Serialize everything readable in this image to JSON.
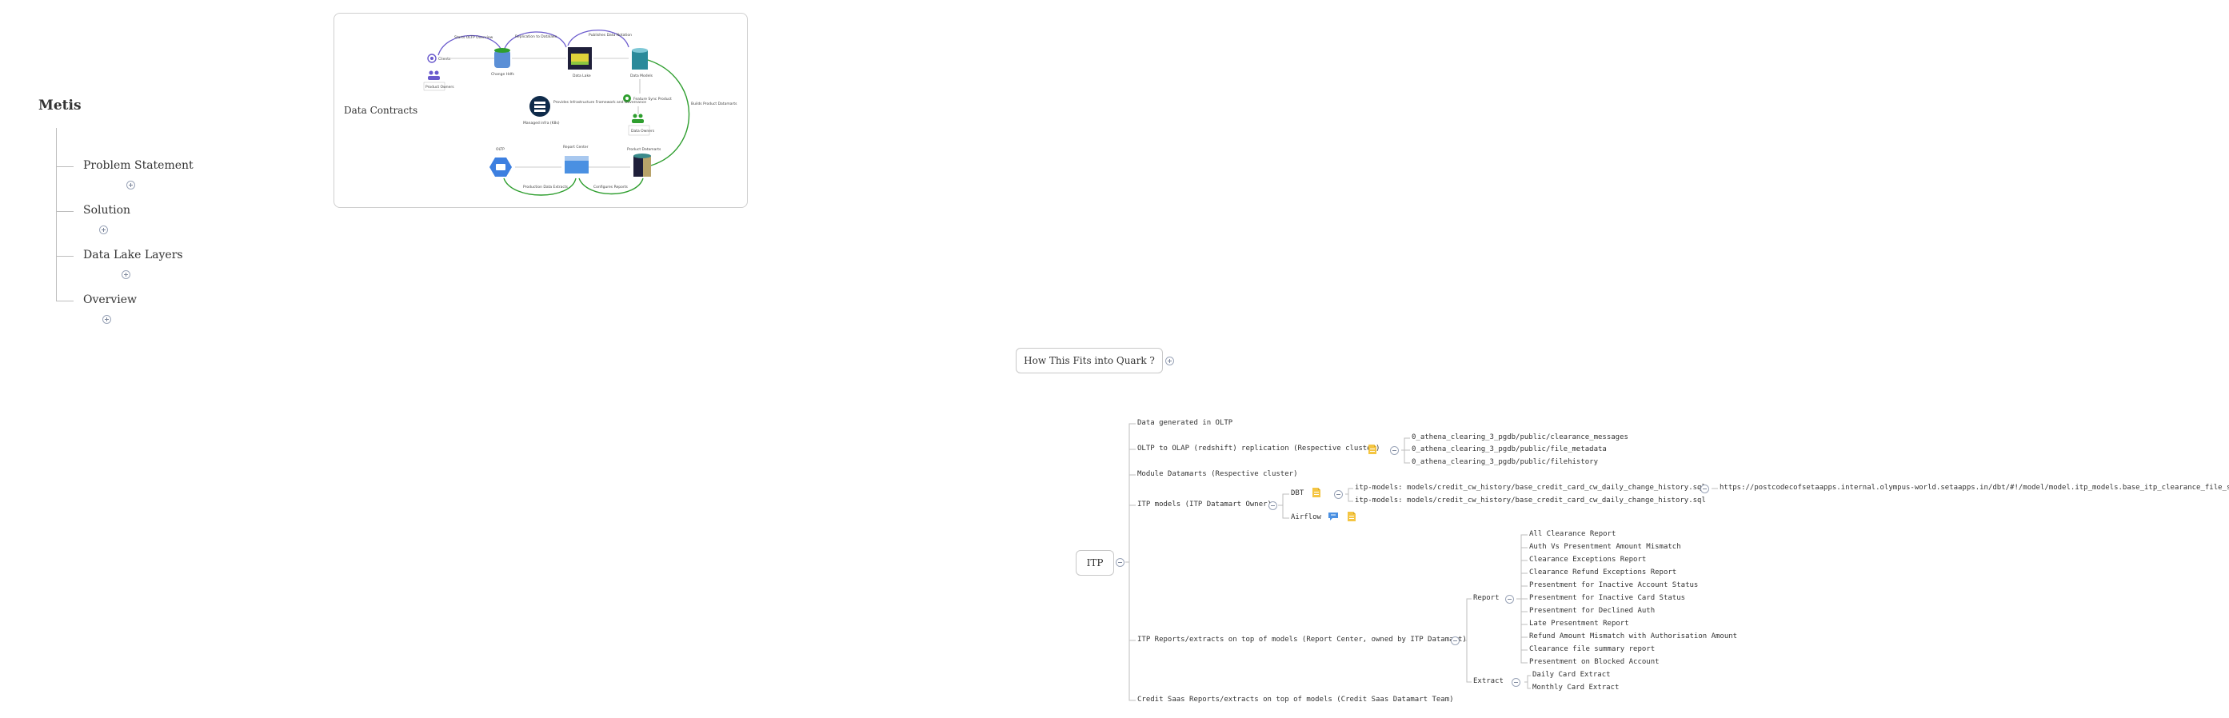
{
  "metis": {
    "title": "Metis",
    "children": [
      "Problem Statement",
      "Solution",
      "Data Lake Layers",
      "Overview"
    ]
  },
  "contracts_card": {
    "label": "Data Contracts",
    "diagram": {
      "top_arcs": [
        "Starts OLTP Overview",
        "Replication to Datalake",
        "Publishes Data Notation"
      ],
      "clients": "Clients",
      "owners": "Product Owners",
      "change_hdfs": "Change Hdfs",
      "data_lake": "Data Lake",
      "data_models": "Data Models",
      "feature_sync": "Feature Sync Product",
      "data_owners": "Data Owners",
      "infra_note": "Provides Infrastructure Framework and Governance",
      "infra_sub": "Managed infra (K8s)",
      "builds": "Builds Product Datamarts",
      "product_datamarts": "Product Datamarts",
      "report_center": "Report Center",
      "oltp": "OLTP",
      "bottom_arcs": [
        "Production Data Extracts",
        "Configures Reports"
      ]
    }
  },
  "quark": {
    "label": "How This Fits into Quark ?"
  },
  "itp": {
    "root": "ITP",
    "items": [
      "Data generated in OLTP",
      "OLTP to OLAP (redshift) replication (Respective cluster)",
      "Module Datamarts (Respective cluster)",
      "ITP models (ITP Datamart Owner)",
      "ITP Reports/extracts on top of models (Report Center, owned by ITP Datamart)",
      "Credit Saas Reports/extracts on top of models (Credit Saas Datamart Team)"
    ],
    "replication_tables": [
      "0_athena_clearing_3_pgdb/public/clearance_messages",
      "0_athena_clearing_3_pgdb/public/file_metadata",
      "0_athena_clearing_3_pgdb/public/filehistory"
    ],
    "models": {
      "dbt_label": "DBT",
      "airflow_label": "Airflow",
      "dbt_files": [
        "itp-models: models/credit_cw_history/base_credit_card_cw_daily_change_history.sql",
        "itp-models: models/credit_cw_history/base_credit_card_cw_daily_change_history.sql"
      ],
      "dbt_link": "https://postcodecofsetaapps.internal.olympus-world.setaapps.in/dbt/#!/model/model.itp_models.base_itp_clearance_file_summary"
    },
    "report_label": "Report",
    "extract_label": "Extract",
    "reports": [
      "All Clearance Report",
      "Auth Vs Presentment Amount Mismatch",
      "Clearance Exceptions Report",
      "Clearance Refund Exceptions Report",
      "Presentment for Inactive Account Status",
      "Presentment for Inactive Card Status",
      "Presentment for Declined Auth",
      "Late Presentment Report",
      "Refund Amount Mismatch with Authorisation Amount",
      "Clearance file summary report",
      "Presentment on Blocked Account"
    ],
    "extracts": [
      "Daily Card Extract",
      "Monthly Card Extract"
    ]
  },
  "colors": {
    "arc_purple": "#6a5acd",
    "arc_green": "#2e9e2e",
    "note_yellow": "#f4c542",
    "chat_blue": "#4a90e2",
    "connector": "#bdbdbd"
  }
}
